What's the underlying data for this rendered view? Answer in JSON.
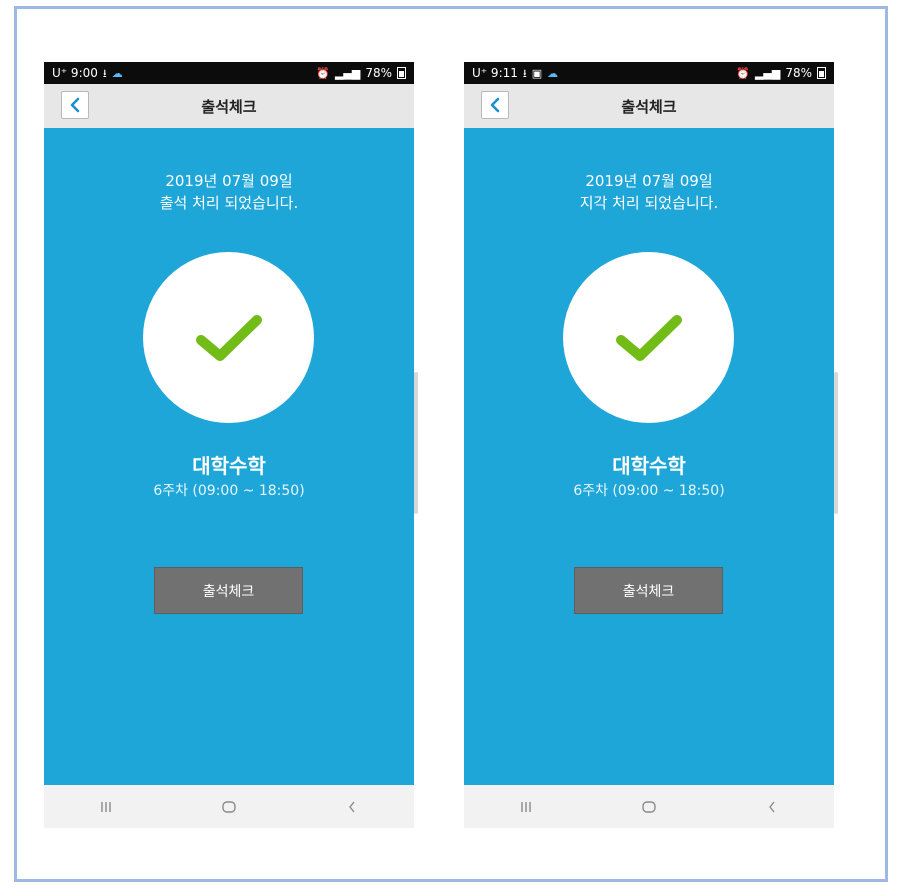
{
  "screens": [
    {
      "status": {
        "time": "U⁺ 9:00",
        "battery": "78%"
      },
      "header": {
        "title": "출석체크"
      },
      "message": {
        "date": "2019년 07월 09일",
        "status": "출석 처리 되었습니다."
      },
      "course": {
        "name": "대학수학",
        "week": "6주차 (09:00 ~ 18:50)"
      },
      "button": {
        "label": "출석체크"
      }
    },
    {
      "status": {
        "time": "U⁺ 9:11",
        "battery": "78%"
      },
      "header": {
        "title": "출석체크"
      },
      "message": {
        "date": "2019년 07월 09일",
        "status": "지각 처리 되었습니다."
      },
      "course": {
        "name": "대학수학",
        "week": "6주차 (09:00 ~ 18:50)"
      },
      "button": {
        "label": "출석체크"
      }
    }
  ],
  "icons": {
    "back": "chevron-left-icon",
    "check": "checkmark-icon",
    "nav_recents": "recents-icon",
    "nav_home": "home-icon",
    "nav_back": "nav-back-icon"
  },
  "colors": {
    "background": "#1ea6d8",
    "check": "#72bc18",
    "button": "#717171",
    "appbar": "#e7e7e7"
  }
}
